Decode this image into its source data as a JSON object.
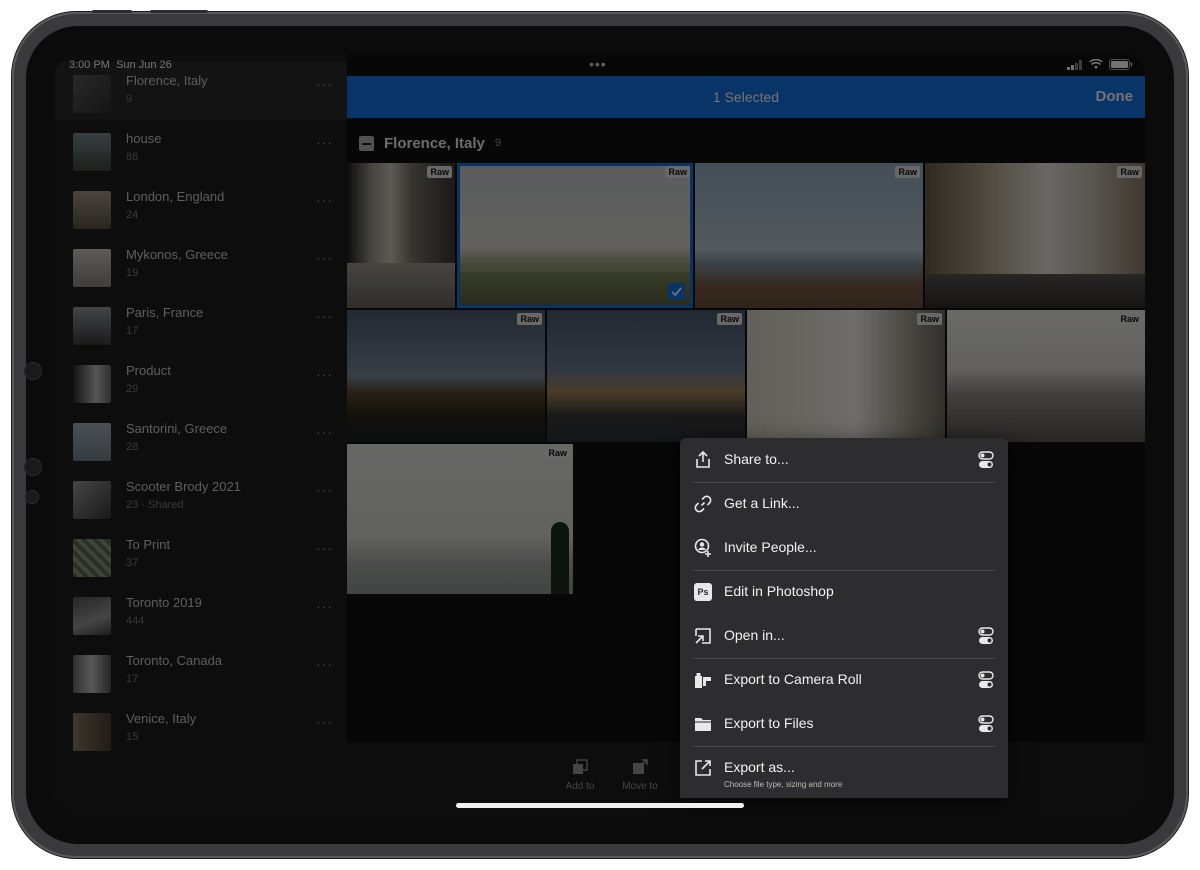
{
  "status_bar": {
    "time": "3:00 PM",
    "date": "Sun Jun 26",
    "dots": "•••"
  },
  "sidebar": {
    "more": "···",
    "items": [
      {
        "title": "Florence, Italy",
        "count": "9"
      },
      {
        "title": "house",
        "count": "88"
      },
      {
        "title": "London, England",
        "count": "24"
      },
      {
        "title": "Mykonos, Greece",
        "count": "19"
      },
      {
        "title": "Paris, France",
        "count": "17"
      },
      {
        "title": "Product",
        "count": "29"
      },
      {
        "title": "Santorini, Greece",
        "count": "28"
      },
      {
        "title": "Scooter Brody 2021",
        "count": "23 · Shared"
      },
      {
        "title": "To Print",
        "count": "37"
      },
      {
        "title": "Toronto 2019",
        "count": "444"
      },
      {
        "title": "Toronto, Canada",
        "count": "17"
      },
      {
        "title": "Venice, Italy",
        "count": "15"
      }
    ]
  },
  "header": {
    "selected": "1 Selected",
    "done": "Done"
  },
  "section": {
    "title": "Florence, Italy",
    "count": "9"
  },
  "photos": {
    "badge": "Raw"
  },
  "toolbar": {
    "add_to": "Add to",
    "move_to": "Move to"
  },
  "menu": {
    "items": [
      {
        "label": "Share to...",
        "icon": "share-icon"
      },
      {
        "label": "Get a Link...",
        "icon": "link-icon"
      },
      {
        "label": "Invite People...",
        "icon": "invite-people-icon"
      },
      {
        "label": "Edit in Photoshop",
        "icon": "photoshop-icon",
        "icon_text": "Ps"
      },
      {
        "label": "Open in...",
        "icon": "open-in-icon"
      },
      {
        "label": "Export to Camera Roll",
        "icon": "camera-roll-icon"
      },
      {
        "label": "Export to Files",
        "icon": "folder-icon"
      },
      {
        "label": "Export as...",
        "sub": "Choose file type, sizing and more",
        "icon": "export-as-icon"
      }
    ]
  },
  "colors": {
    "accent": "#1473e6",
    "menu_bg": "#2d2d2f",
    "sidebar_bg": "#1d1d1f"
  }
}
